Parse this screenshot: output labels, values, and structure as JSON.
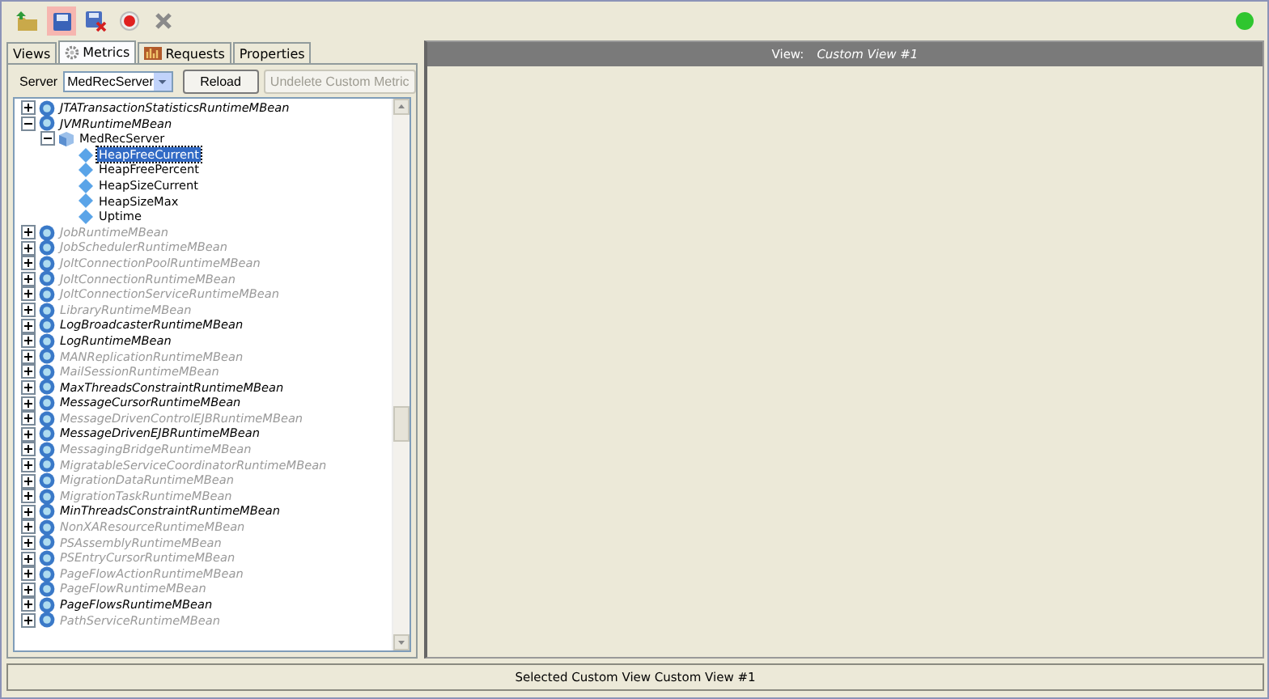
{
  "toolbar": {
    "buttons": [
      {
        "kind": "open",
        "selected": false
      },
      {
        "kind": "save",
        "selected": true
      },
      {
        "kind": "discard",
        "selected": false
      },
      {
        "kind": "record",
        "selected": false
      },
      {
        "kind": "close",
        "selected": false
      }
    ]
  },
  "tabs": [
    {
      "label": "Views",
      "selected": false
    },
    {
      "label": "Metrics",
      "selected": true
    },
    {
      "label": "Requests",
      "selected": false
    },
    {
      "label": "Properties",
      "selected": false
    }
  ],
  "server": {
    "label": "Server",
    "value": "MedRecServer"
  },
  "buttons": [
    {
      "label": "Reload",
      "disabled": false
    },
    {
      "label": "Undelete Custom Metric",
      "disabled": true
    }
  ],
  "tree": [
    {
      "kind": "mbean",
      "label": "JTATransactionStatisticsRuntimeMBean",
      "active": true,
      "expanded": false
    },
    {
      "kind": "mbean",
      "label": "JVMRuntimeMBean",
      "active": true,
      "expanded": true,
      "children": [
        {
          "kind": "server",
          "label": "MedRecServer",
          "expanded": true,
          "children": [
            {
              "kind": "metric",
              "label": "HeapFreeCurrent",
              "selected": true
            },
            {
              "kind": "metric",
              "label": "HeapFreePercent",
              "selected": false
            },
            {
              "kind": "metric",
              "label": "HeapSizeCurrent",
              "selected": false
            },
            {
              "kind": "metric",
              "label": "HeapSizeMax",
              "selected": false
            },
            {
              "kind": "metric",
              "label": "Uptime",
              "selected": false
            }
          ]
        }
      ]
    },
    {
      "kind": "mbean",
      "label": "JobRuntimeMBean",
      "active": false,
      "expanded": false
    },
    {
      "kind": "mbean",
      "label": "JobSchedulerRuntimeMBean",
      "active": false,
      "expanded": false
    },
    {
      "kind": "mbean",
      "label": "JoltConnectionPoolRuntimeMBean",
      "active": false,
      "expanded": false
    },
    {
      "kind": "mbean",
      "label": "JoltConnectionRuntimeMBean",
      "active": false,
      "expanded": false
    },
    {
      "kind": "mbean",
      "label": "JoltConnectionServiceRuntimeMBean",
      "active": false,
      "expanded": false
    },
    {
      "kind": "mbean",
      "label": "LibraryRuntimeMBean",
      "active": false,
      "expanded": false
    },
    {
      "kind": "mbean",
      "label": "LogBroadcasterRuntimeMBean",
      "active": true,
      "expanded": false
    },
    {
      "kind": "mbean",
      "label": "LogRuntimeMBean",
      "active": true,
      "expanded": false
    },
    {
      "kind": "mbean",
      "label": "MANReplicationRuntimeMBean",
      "active": false,
      "expanded": false
    },
    {
      "kind": "mbean",
      "label": "MailSessionRuntimeMBean",
      "active": false,
      "expanded": false
    },
    {
      "kind": "mbean",
      "label": "MaxThreadsConstraintRuntimeMBean",
      "active": true,
      "expanded": false
    },
    {
      "kind": "mbean",
      "label": "MessageCursorRuntimeMBean",
      "active": true,
      "expanded": false
    },
    {
      "kind": "mbean",
      "label": "MessageDrivenControlEJBRuntimeMBean",
      "active": false,
      "expanded": false
    },
    {
      "kind": "mbean",
      "label": "MessageDrivenEJBRuntimeMBean",
      "active": true,
      "expanded": false
    },
    {
      "kind": "mbean",
      "label": "MessagingBridgeRuntimeMBean",
      "active": false,
      "expanded": false
    },
    {
      "kind": "mbean",
      "label": "MigratableServiceCoordinatorRuntimeMBean",
      "active": false,
      "expanded": false
    },
    {
      "kind": "mbean",
      "label": "MigrationDataRuntimeMBean",
      "active": false,
      "expanded": false
    },
    {
      "kind": "mbean",
      "label": "MigrationTaskRuntimeMBean",
      "active": false,
      "expanded": false
    },
    {
      "kind": "mbean",
      "label": "MinThreadsConstraintRuntimeMBean",
      "active": true,
      "expanded": false
    },
    {
      "kind": "mbean",
      "label": "NonXAResourceRuntimeMBean",
      "active": false,
      "expanded": false
    },
    {
      "kind": "mbean",
      "label": "PSAssemblyRuntimeMBean",
      "active": false,
      "expanded": false
    },
    {
      "kind": "mbean",
      "label": "PSEntryCursorRuntimeMBean",
      "active": false,
      "expanded": false
    },
    {
      "kind": "mbean",
      "label": "PageFlowActionRuntimeMBean",
      "active": false,
      "expanded": false
    },
    {
      "kind": "mbean",
      "label": "PageFlowRuntimeMBean",
      "active": false,
      "expanded": false
    },
    {
      "kind": "mbean",
      "label": "PageFlowsRuntimeMBean",
      "active": true,
      "expanded": false
    },
    {
      "kind": "mbean",
      "label": "PathServiceRuntimeMBean",
      "active": false,
      "expanded": false
    }
  ],
  "view": {
    "label": "View:",
    "name": "Custom View #1"
  },
  "status_bar": "Selected Custom View Custom View #1"
}
